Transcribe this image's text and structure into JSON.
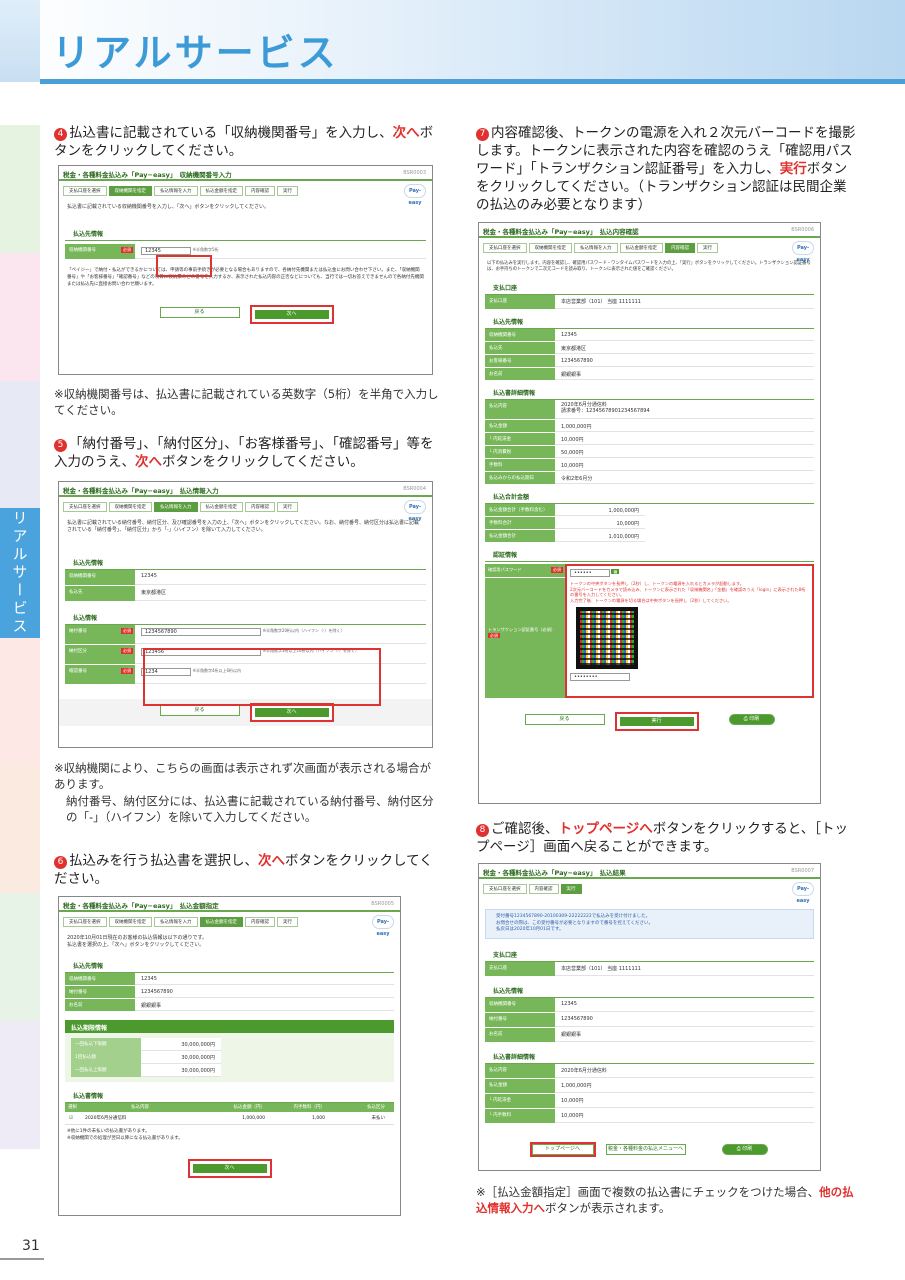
{
  "header": {
    "title": "リアルサービス",
    "side_tab": "リアルサービス",
    "page_number": "31"
  },
  "steps": {
    "s4": {
      "num": "4",
      "text_a": "払込書に記載されている「収納機関番号」を入力し、",
      "red": "次へ",
      "text_b": "ボタンをクリックしてください。"
    },
    "s4_note": "※収納機関番号は、払込書に記載されている英数字（5桁）を半角で入力してください。",
    "s5": {
      "num": "5",
      "text_a": "「納付番号」、「納付区分」、「お客様番号」、「確認番号」等を入力のうえ、",
      "red": "次へ",
      "text_b": "ボタンをクリックしてください。"
    },
    "s5_note1": "※収納機関により、こちらの画面は表示されず次画面が表示される場合があります。",
    "s5_note2": "納付番号、納付区分には、払込書に記載されている納付番号、納付区分の「-」（ハイフン）を除いて入力してください。",
    "s6": {
      "num": "6",
      "text_a": "払込みを行う払込書を選択し、",
      "red": "次へ",
      "text_b": "ボタンをクリックしてください。"
    },
    "s7": {
      "num": "7",
      "text_a": "内容確認後、トークンの電源を入れ２次元バーコードを撮影します。トークンに表示された内容を確認のうえ「確認用パスワード」「トランザクション認証番号」を入力し、",
      "red": "実行",
      "text_b": "ボタンをクリックしてください。（トランザクション認証は民間企業の払込のみ必要となります）"
    },
    "s8": {
      "num": "8",
      "text_a": "ご確認後、",
      "red": "トップページへ",
      "text_b": "ボタンをクリックすると、［トップページ］画面へ戻ることができます。"
    },
    "s8_note_a": "※［払込金額指定］画面で複数の払込書にチェックをつけた場合、",
    "s8_note_red": "他の払込情報入力へ",
    "s8_note_b": "ボタンが表示されます。"
  },
  "common": {
    "app": "税金・各種料金払込み「Pay−easy」",
    "logo": "Pay-easy",
    "back": "戻る",
    "next": "次へ",
    "exec": "実行",
    "print": "印刷",
    "top": "トップページへ",
    "menu": "税金・各種料金の払込メニューへ",
    "crumbs": [
      "支払口座を選択",
      "収納機関を指定",
      "払込情報を入力",
      "払込金額を指定",
      "内容確認",
      "実行"
    ]
  },
  "shot4": {
    "screen": "収納機関番号入力",
    "code": "BSR0003",
    "msg": "払込書に記載されている収納機関番号を入力し、「次へ」ボタンをクリックしてください。",
    "sect": "払込先情報",
    "label": "収納機関番号",
    "req": "必須",
    "value": "12345",
    "hint": "※半角数字5桁",
    "body": "「ペイジー」で納付・払込ができるかについては、申請等の事前手続きが必要となる場合もありますので、各納付先機関または払込金にお問い合わせ下さい。また、「収納機関番号」や「お客様番号」「確認番号」などの項目に収納票のどの番号を入力するか、表示された払込内容の正否などについても、当行では一切お答えできませんので各納付先機関または払込先に直接お問い合わせ願います。"
  },
  "shot5": {
    "screen": "払込情報入力",
    "code": "BSR0004",
    "msg": "払込書に記載されている納付番号、納付区分、及び確認番号を入力の上、「次へ」ボタンをクリックしてください。なお、納付番号、納付区分は払込書に記載されている「納付番号」、「納付区分」から「-」（ハイフン）を除いて入力してください。",
    "sect1": "払込先情報",
    "r1l": "収納機関番号",
    "r1v": "12345",
    "r2l": "払込先",
    "r2v": "東京都港区",
    "sect2": "払込情報",
    "f1l": "納付番号",
    "f1v": "1234567890",
    "f1h": "※半角数字20桁以内（ハイフン（-）を除く）",
    "f2l": "納付区分",
    "f2v": "123456",
    "f2h": "※半角数字3桁以上16桁以内（ハイフン（-）を除く）",
    "f3l": "確認番号",
    "f3v": "1234",
    "f3h": "※半角数字4桁以上6桁以内",
    "req": "必須"
  },
  "shot6": {
    "screen": "払込金額指定",
    "code": "BSR0005",
    "msg1": "2020年10月01日現在のお客様の払込情報は以下の通りです。",
    "msg2": "払込書を選択の上、「次へ」ボタンをクリックしてください。",
    "sect1": "払込先情報",
    "r1l": "収納機関番号",
    "r1v": "12345",
    "r2l": "納付番号",
    "r2v": "1234567890",
    "r3l": "お名前",
    "r3v": "銀銀銀事",
    "sect2": "払込期限情報",
    "p1l": "一回払込下限額",
    "p1v": "30,000,000円",
    "p2l": "1回払込額",
    "p2v": "30,000,000円",
    "p3l": "一回払込上限額",
    "p3v": "30,000,000円",
    "sect3": "払込書情報",
    "th": [
      "選択",
      "払込内容",
      "払込金額（円）",
      "内手数料（円）",
      "払込区分"
    ],
    "td": [
      "2020年6月分通信料",
      "1,000,000",
      "1,000",
      "未払い"
    ],
    "foot1": "※他に1件の未払いの払込書があります。",
    "foot2": "※収納機関での処理が翌日以降になる払込書があります。"
  },
  "shot7": {
    "screen": "払込内容確認",
    "code": "BSR0006",
    "msg": "以下の払込みを実行します。内容を確認し、確認用パスワード・ワンタイムパスワードを入力の上、「実行」ボタンをクリックしてください。トランザクション認証番号は、お手持ちのトークンで二次元コードを読み取り、トークンに表示された値をご確認ください。",
    "sect1": "支払口座",
    "a1l": "支払口座",
    "a1v": "本店営業部（101） 当座 1111111",
    "sect2": "払込先情報",
    "b1l": "収納機関番号",
    "b1v": "12345",
    "b2l": "払込先",
    "b2v": "東京都港区",
    "b3l": "お客様番号",
    "b3v": "1234567890",
    "b4l": "お名前",
    "b4v": "銀銀銀事",
    "sect3": "払込書詳細情報",
    "c1l": "払込内容",
    "c1v": "2020年6月分通信料",
    "c1v2": "請求番号：12345678901234567894",
    "c2l": "払込金額",
    "c2v": "1,000,000円",
    "c3l": "└ 内延滞金",
    "c3v": "10,000円",
    "c4l": "└ 内消費税",
    "c4v": "50,000円",
    "c5l": "手数料",
    "c5v": "10,000円",
    "c6l": "払込みからの払込期日",
    "c6v": "令和2年6月分",
    "sect4": "払込合計金額",
    "d1l": "払込金額合計（手数料含む）",
    "d1v": "1,000,000円",
    "d2l": "手数料合計",
    "d2v": "10,000円",
    "d3l": "払込金額合計",
    "d3v": "1,010,000円",
    "sect5": "認証情報",
    "e1l": "確認用パスワード",
    "e1v": "••••••",
    "e2l": "トランザクション認証番号（必須）",
    "req": "必須",
    "tk1": "トークンの中央ボタンを長押し（2秒）し、トークンの電源を入れるとカメラが起動します。",
    "tk2": "2次元バーコードをカメラで読み込み、トークンに表示された「収納機関名」「金額」を確認のうえ「login」に表示された8桁の番号を入力してください。",
    "tk3": "入力完了後、トークンの電源を切る場合は中央ボタンを長押し（2秒）してください。",
    "e2v": "••••••••"
  },
  "shot8": {
    "screen": "払込結果",
    "code": "BSR0007",
    "m1": "受付番号1234567890-20100309-22222222で払込みを受け付けました。",
    "m2": "お問合せの際は、この受付番号が必要となりますので番号を控えてください。",
    "m3": "払戻日は2020年10月01日です。",
    "sect1": "支払口座",
    "a1l": "支払口座",
    "a1v": "本店営業部（101） 当座 1111111",
    "sect2": "払込先情報",
    "b1l": "収納機関番号",
    "b1v": "12345",
    "b2l": "納付番号",
    "b2v": "1234567890",
    "b3l": "お名前",
    "b3v": "銀銀銀事",
    "sect3": "払込書詳細情報",
    "c1l": "払込内容",
    "c1v": "2020年6月分通信料",
    "c2l": "払込金額",
    "c2v": "1,000,000円",
    "c3l": "└ 内延滞金",
    "c3v": "10,000円",
    "c4l": "└ 内手数料",
    "c4v": "10,000円"
  }
}
